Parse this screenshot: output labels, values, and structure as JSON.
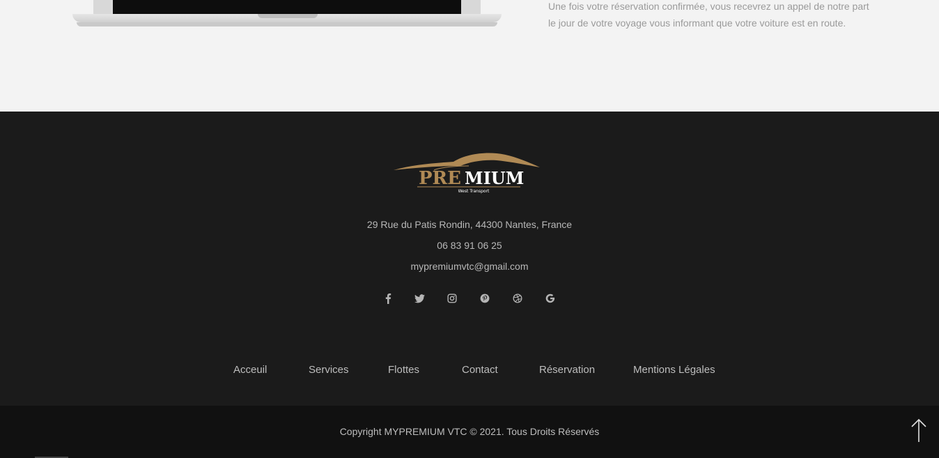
{
  "top": {
    "text": "Une fois votre réservation confirmée, vous recevrez un appel de notre part le jour de votre voyage vous informant que votre voiture est en route."
  },
  "logo": {
    "brand_pre": "PRE",
    "brand_rest": "MIUM",
    "tagline": "West Transport",
    "accent_color": "#b08a55"
  },
  "contact": {
    "address": "29 Rue du Patis Rondin, 44300 Nantes, France",
    "phone": "06 83 91 06 25",
    "email": "mypremiumvtc@gmail.com"
  },
  "socials": [
    {
      "icon": "facebook-icon",
      "glyph": "f"
    },
    {
      "icon": "twitter-icon",
      "glyph": "t"
    },
    {
      "icon": "instagram-icon",
      "glyph": "i"
    },
    {
      "icon": "pinterest-icon",
      "glyph": "p"
    },
    {
      "icon": "dribbble-icon",
      "glyph": "d"
    },
    {
      "icon": "google-icon",
      "glyph": "G"
    }
  ],
  "nav": {
    "items": [
      "Acceuil",
      "Services",
      "Flottes",
      "Contact",
      "Réservation",
      "Mentions Légales"
    ]
  },
  "footer": {
    "copyright": "Copyright MYPREMIUM VTC © 2021. Tous Droits Réservés"
  },
  "colors": {
    "footer_bg": "#1b1b1b",
    "bottom_bg": "#111111",
    "top_bg": "#f3f3f3"
  }
}
